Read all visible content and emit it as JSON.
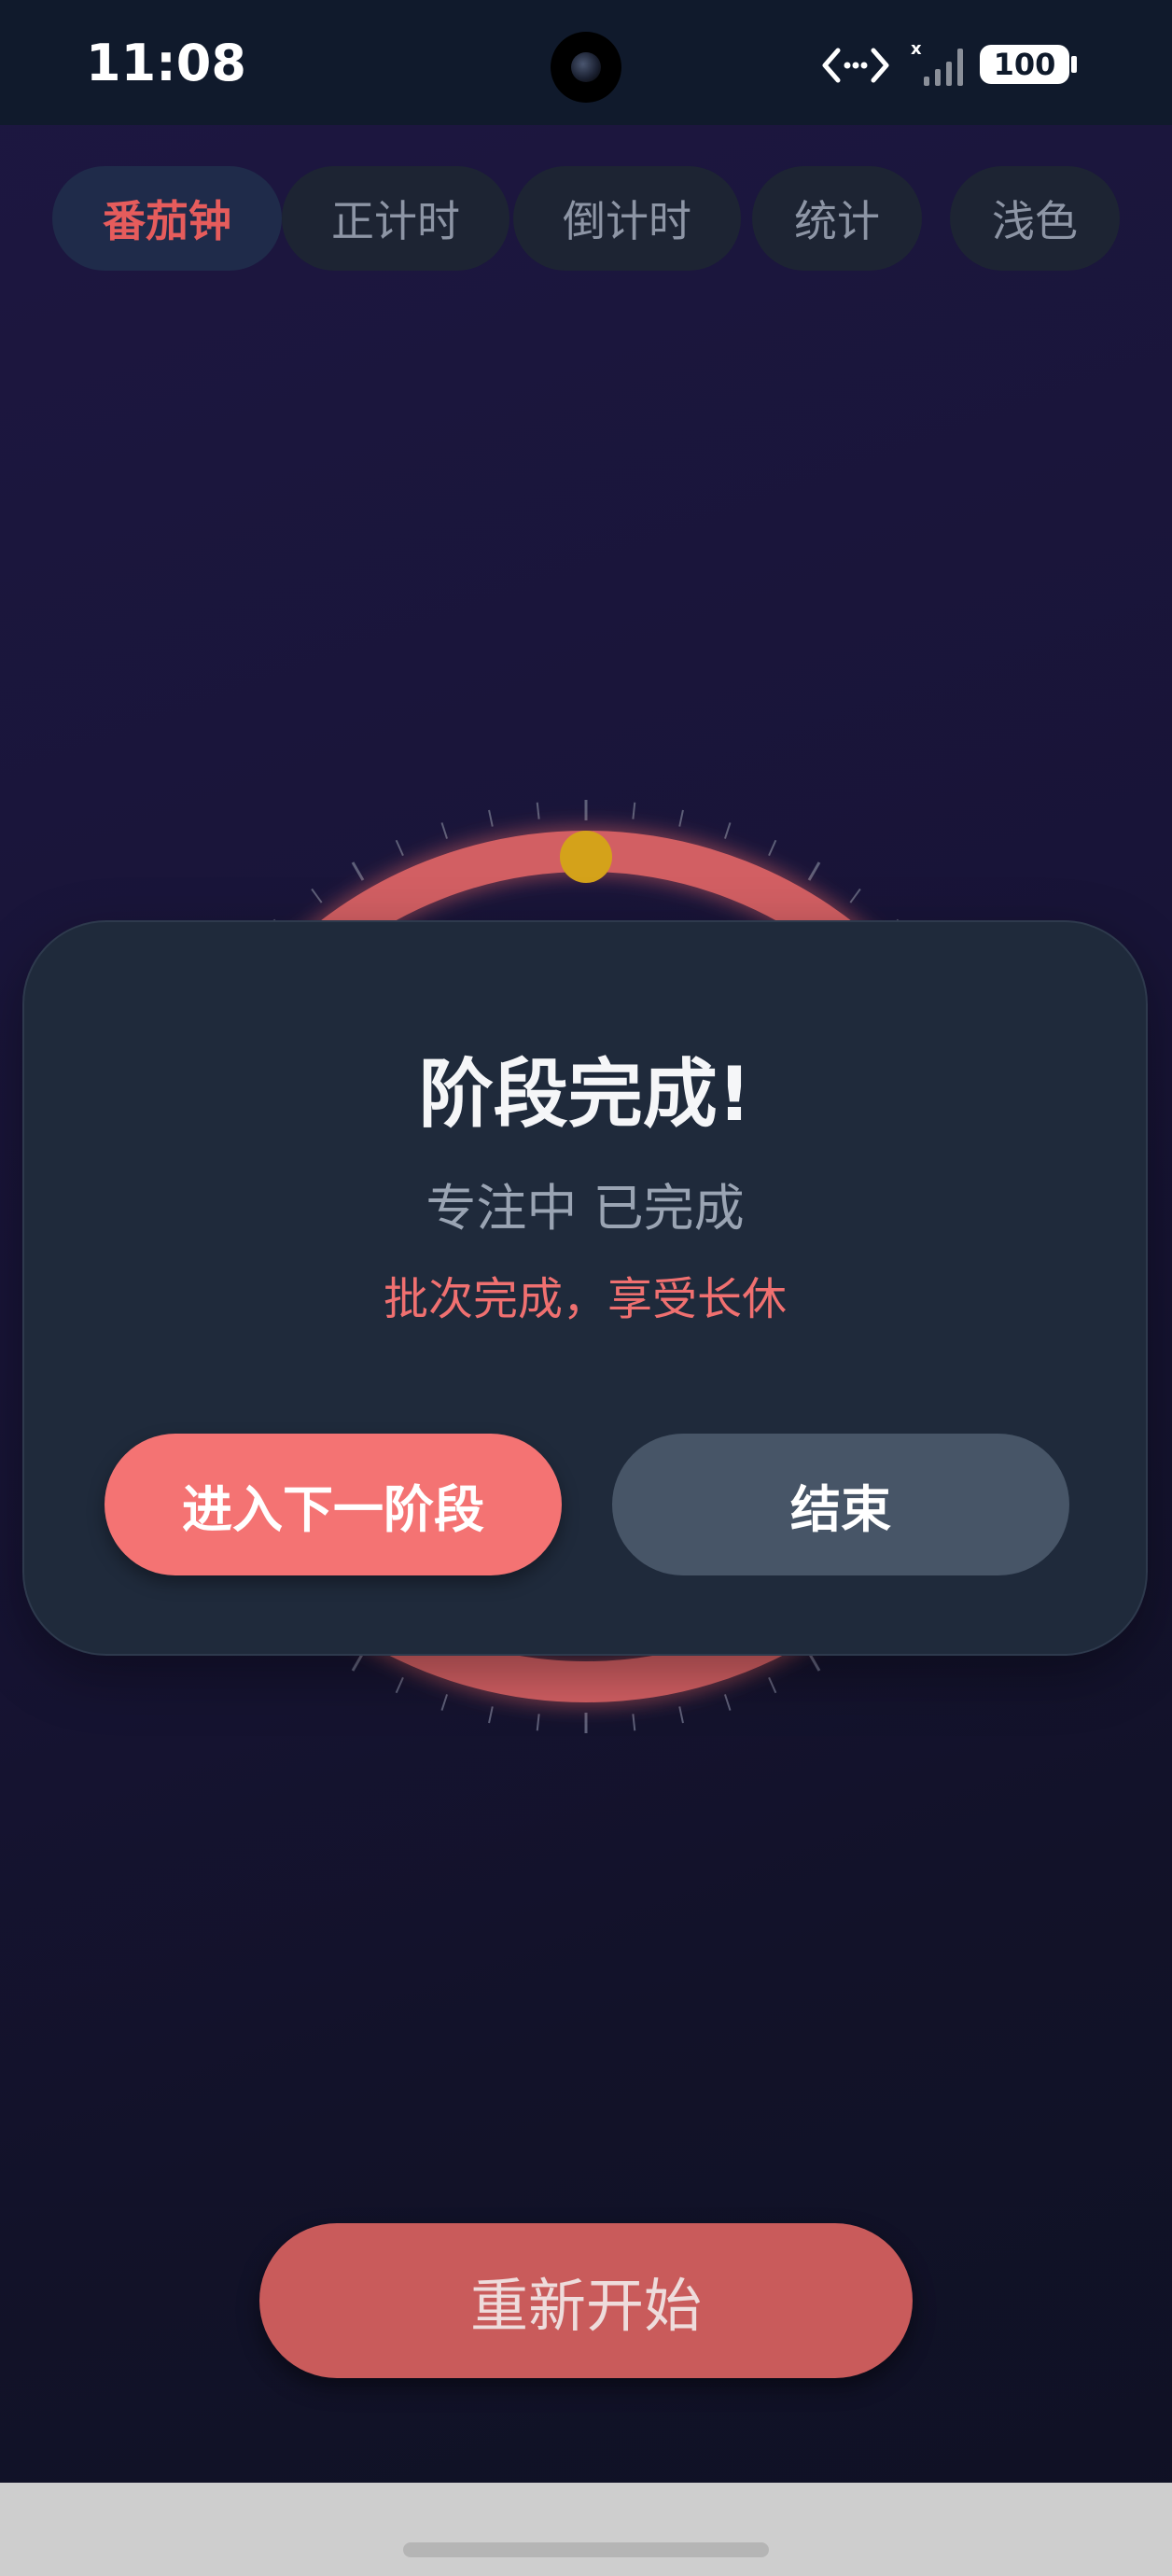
{
  "status_bar": {
    "time": "11:08",
    "battery": "100",
    "icons": [
      "network-transfer-icon",
      "signal-no-sim-icon",
      "battery-icon"
    ]
  },
  "tabs": [
    {
      "label": "番茄钟",
      "active": true
    },
    {
      "label": "正计时",
      "active": false
    },
    {
      "label": "倒计时",
      "active": false
    },
    {
      "label": "统计",
      "active": false
    },
    {
      "label": "浅色",
      "active": false
    }
  ],
  "timer": {
    "ring_color": "#e06363",
    "indicator_color": "#d4a21a"
  },
  "dialog": {
    "title": "阶段完成!",
    "subtitle": "专注中 已完成",
    "note": "批次完成，享受长休",
    "next_button": "进入下一阶段",
    "end_button": "结束"
  },
  "restart_button": "重新开始",
  "colors": {
    "accent": "#f47373",
    "tab_active_text": "#e65c5c",
    "background": "#181437"
  }
}
